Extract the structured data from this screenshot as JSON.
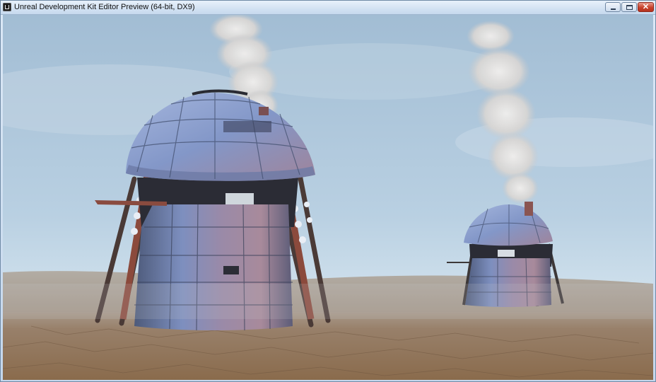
{
  "window": {
    "title": "Unreal Development Kit Editor Preview (64-bit, DX9)",
    "icon": "udk-logo-icon"
  },
  "controls": {
    "minimize": "minimize-icon",
    "maximize": "maximize-icon",
    "close": "close-icon"
  },
  "scene": {
    "description_icon": "game-viewport",
    "colors": {
      "sky_top": "#a7c2d8",
      "sky_horizon": "#cfe1ec",
      "ground": "#8a6e52",
      "dome_metal": "#8fa3c8",
      "smoke": "#e2e0de"
    }
  }
}
